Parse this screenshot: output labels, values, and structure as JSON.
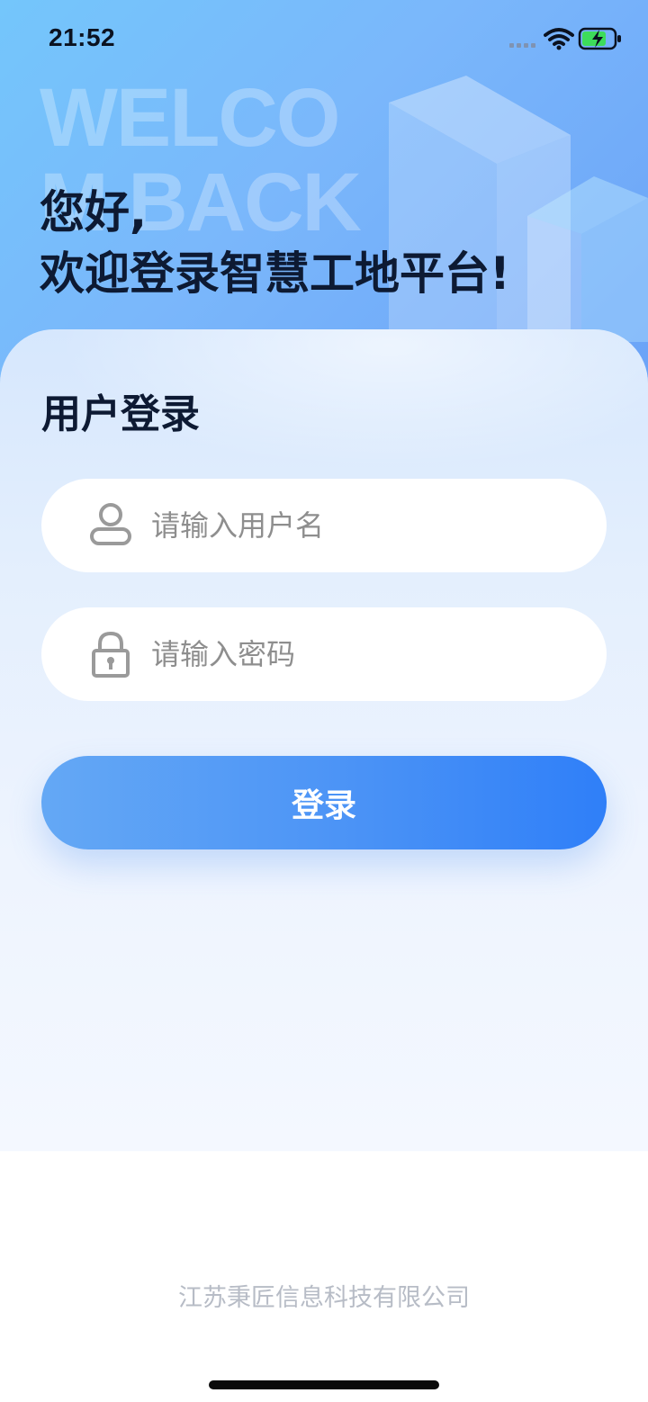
{
  "status_bar": {
    "time": "21:52",
    "icons": [
      "signal-icon",
      "wifi-icon",
      "battery-charging-icon"
    ]
  },
  "hero": {
    "watermark": "WELCOM BACK",
    "greeting_line1": "您好,",
    "greeting_line2": "欢迎登录智慧工地平台!"
  },
  "login": {
    "title": "用户登录",
    "username": {
      "placeholder": "请输入用户名",
      "value": "",
      "icon": "user-icon"
    },
    "password": {
      "placeholder": "请输入密码",
      "value": "",
      "icon": "lock-icon"
    },
    "submit_label": "登录"
  },
  "footer": {
    "company": "江苏秉匠信息科技有限公司"
  },
  "colors": {
    "primary": "#3a86f7",
    "hero_bg": "#7ab7fb",
    "title_text": "#0d1a33",
    "placeholder": "#8e8e8e",
    "footer_text": "#b7bcc6"
  }
}
